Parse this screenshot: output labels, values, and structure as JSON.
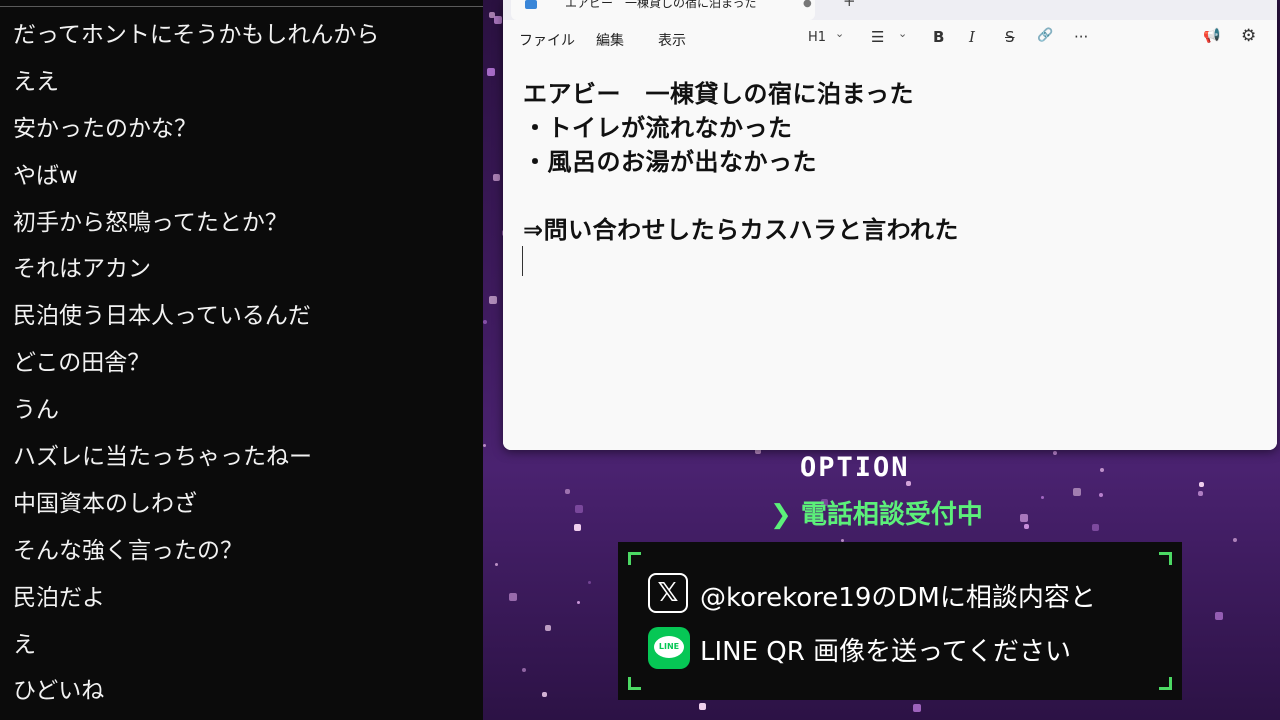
{
  "chat": {
    "messages": [
      "だってホントにそうかもしれんから",
      "ええ",
      "安かったのかな？",
      "やばw",
      "初手から怒鳴ってたとか？",
      "それはアカン",
      "民泊使う日本人っているんだ",
      "どこの田舎？",
      "うん",
      "ハズレに当たっちゃったねー",
      "中国資本のしわざ",
      "そんな強く言ったの？",
      "民泊だよ",
      "え",
      "ひどいね"
    ]
  },
  "notepad": {
    "tab_title": "エアビー　一棟貸しの宿に泊まった",
    "tab_unsaved": "●",
    "new_tab": "+",
    "menu": [
      "ファイル",
      "編集",
      "表示"
    ],
    "toolbar": {
      "heading": "H1",
      "heading_chevron": "⌄",
      "list": "☰",
      "list_chevron": "⌄",
      "bold": "B",
      "italic": "I",
      "strike": "S",
      "link": "🔗",
      "more": "···",
      "copilot": "📢",
      "settings": "⚙"
    },
    "lines": [
      "エアビー　一棟貸しの宿に泊まった",
      "・トイレが流れなかった",
      "・風呂のお湯が出なかった",
      "",
      "⇒問い合わせしたらカスハラと言われた"
    ]
  },
  "overlay": {
    "option_title": "OPTION",
    "phone_consult": "❯ 電話相談受付中",
    "x_icon_glyph": "𝕏",
    "x_line": "@korekore19のDMに相談内容と",
    "line_icon_label": "LINE",
    "line_line": "LINE QR 画像を送ってください"
  },
  "colors": {
    "accent_green": "#5cf07a",
    "line_green": "#06c755",
    "background_purple": "#3d1a5c"
  }
}
